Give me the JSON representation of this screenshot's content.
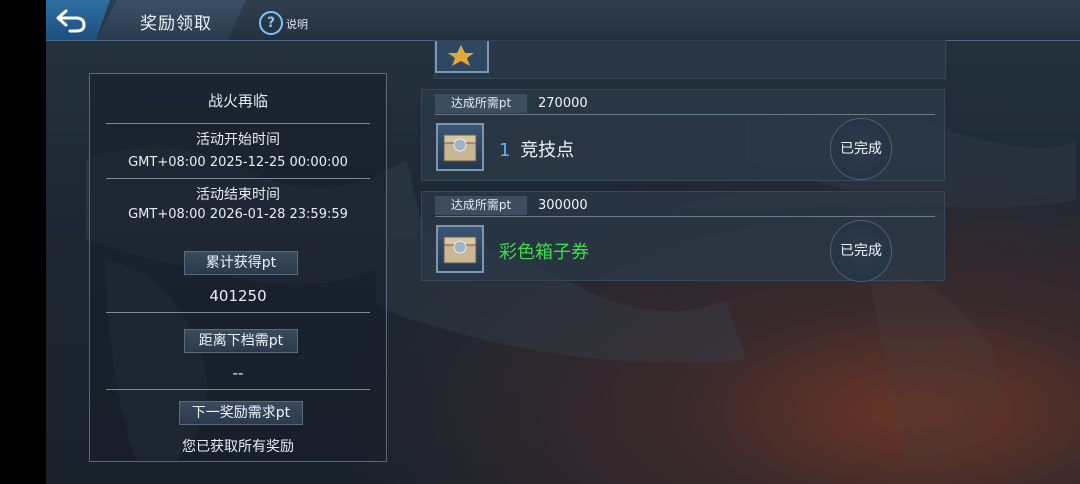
{
  "header": {
    "title": "奖励领取",
    "help_label": "说明"
  },
  "info_panel": {
    "event_name": "战火再临",
    "start_label": "活动开始时间",
    "start_value": "GMT+08:00 2025-12-25 00:00:00",
    "end_label": "活动结束时间",
    "end_value": "GMT+08:00 2026-01-28 23:59:59",
    "total_pt_label": "累计获得pt",
    "total_pt_value": "401250",
    "next_gap_label": "距离下档需pt",
    "next_gap_value": "--",
    "next_req_label": "下一奖励需求pt",
    "next_req_value": "您已获取所有奖励"
  },
  "rewards": [
    {
      "req_label": "达成所需pt",
      "req_value": "270000",
      "qty": "1",
      "name": "竞技点",
      "status": "已完成",
      "name_color": "#eef3f8"
    },
    {
      "req_label": "达成所需pt",
      "req_value": "300000",
      "qty": "",
      "name": "彩色箱子券",
      "status": "已完成",
      "name_color": "#3ddc4a"
    }
  ],
  "colors": {
    "accent_blue": "#5ab4ee",
    "green_item": "#3ddc4a"
  }
}
